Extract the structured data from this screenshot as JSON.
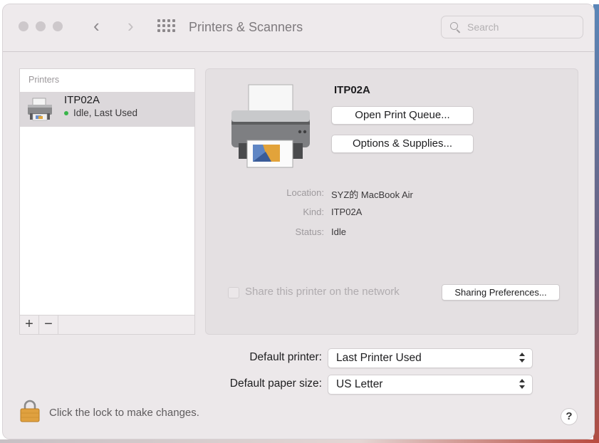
{
  "window": {
    "title": "Printers & Scanners"
  },
  "toolbar": {
    "back_icon": "‹",
    "forward_icon": "›",
    "search_placeholder": "Search"
  },
  "printers_list": {
    "header": "Printers",
    "items": [
      {
        "name": "ITP02A",
        "status": "Idle, Last Used",
        "status_color": "#39b54a"
      }
    ],
    "add_label": "+",
    "remove_label": "−"
  },
  "detail": {
    "name": "ITP02A",
    "open_queue_label": "Open Print Queue...",
    "options_label": "Options & Supplies...",
    "location_label": "Location:",
    "location_value": "SYZ的 MacBook Air",
    "kind_label": "Kind:",
    "kind_value": "ITP02A",
    "status_label": "Status:",
    "status_value": "Idle",
    "share_label": "Share this printer on the network",
    "sharing_prefs_label": "Sharing Preferences..."
  },
  "defaults": {
    "printer_label": "Default printer:",
    "printer_value": "Last Printer Used",
    "paper_label": "Default paper size:",
    "paper_value": "US Letter"
  },
  "footer": {
    "lock_text": "Click the lock to make changes.",
    "help_label": "?"
  }
}
